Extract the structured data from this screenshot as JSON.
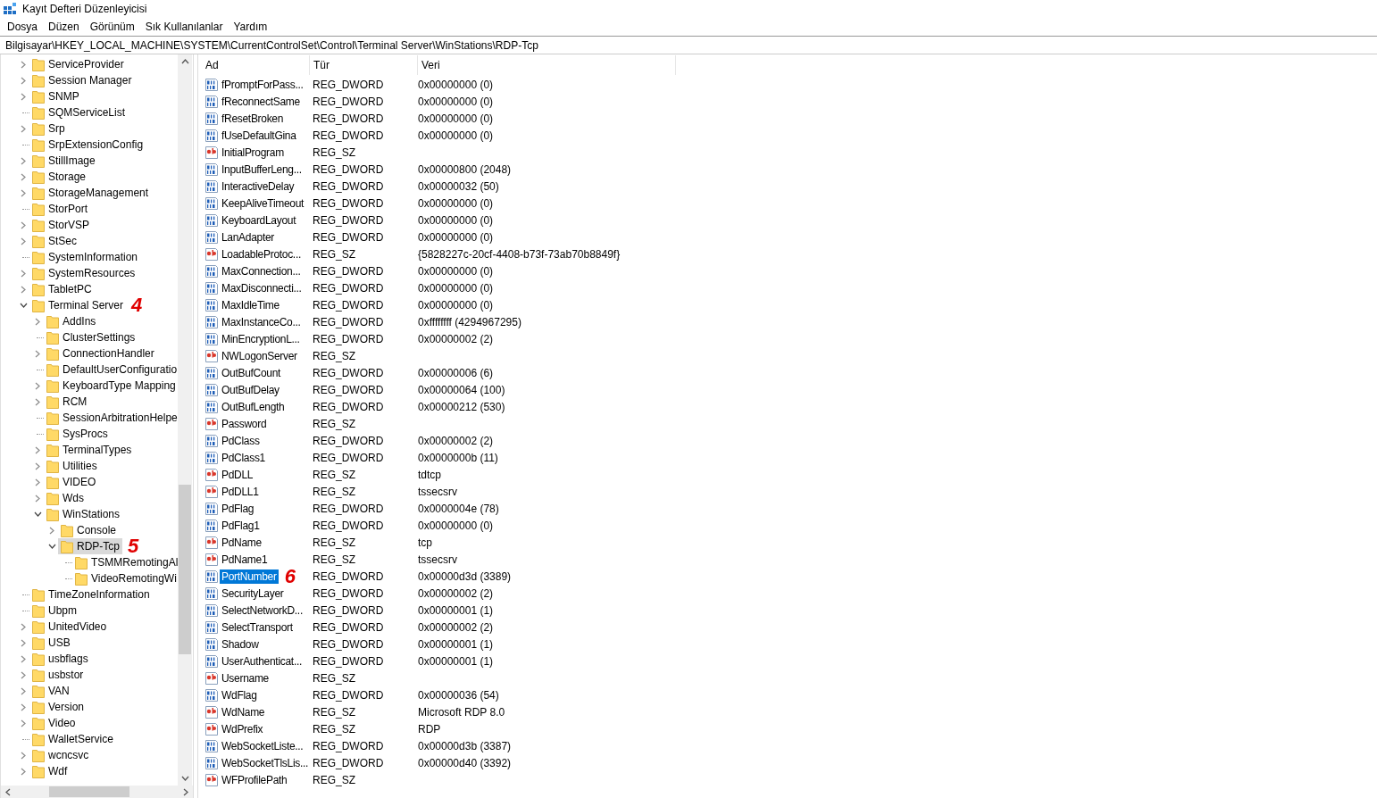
{
  "window": {
    "title": "Kayıt Defteri Düzenleyicisi"
  },
  "menu": [
    "Dosya",
    "Düzen",
    "Görünüm",
    "Sık Kullanılanlar",
    "Yardım"
  ],
  "address": "Bilgisayar\\HKEY_LOCAL_MACHINE\\SYSTEM\\CurrentControlSet\\Control\\Terminal Server\\WinStations\\RDP-Tcp",
  "tree": [
    {
      "label": "ServiceProvider",
      "expandable": true,
      "expanded": false,
      "selected": false
    },
    {
      "label": "Session Manager",
      "expandable": true,
      "expanded": false,
      "selected": false
    },
    {
      "label": "SNMP",
      "expandable": true,
      "expanded": false,
      "selected": false
    },
    {
      "label": "SQMServiceList",
      "expandable": false,
      "selected": false
    },
    {
      "label": "Srp",
      "expandable": true,
      "expanded": false,
      "selected": false
    },
    {
      "label": "SrpExtensionConfig",
      "expandable": false,
      "selected": false
    },
    {
      "label": "StillImage",
      "expandable": true,
      "expanded": false,
      "selected": false
    },
    {
      "label": "Storage",
      "expandable": true,
      "expanded": false,
      "selected": false
    },
    {
      "label": "StorageManagement",
      "expandable": true,
      "expanded": false,
      "selected": false
    },
    {
      "label": "StorPort",
      "expandable": false,
      "selected": false
    },
    {
      "label": "StorVSP",
      "expandable": true,
      "expanded": false,
      "selected": false
    },
    {
      "label": "StSec",
      "expandable": true,
      "expanded": false,
      "selected": false
    },
    {
      "label": "SystemInformation",
      "expandable": false,
      "selected": false
    },
    {
      "label": "SystemResources",
      "expandable": true,
      "expanded": false,
      "selected": false
    },
    {
      "label": "TabletPC",
      "expandable": true,
      "expanded": false,
      "selected": false
    },
    {
      "label": "Terminal Server",
      "expandable": true,
      "expanded": true,
      "selected": false,
      "annotation": "4",
      "children": [
        {
          "label": "AddIns",
          "expandable": true,
          "expanded": false,
          "selected": false
        },
        {
          "label": "ClusterSettings",
          "expandable": false,
          "selected": false
        },
        {
          "label": "ConnectionHandler",
          "expandable": true,
          "expanded": false,
          "selected": false
        },
        {
          "label": "DefaultUserConfiguratio",
          "expandable": false,
          "selected": false
        },
        {
          "label": "KeyboardType Mapping",
          "expandable": true,
          "expanded": false,
          "selected": false
        },
        {
          "label": "RCM",
          "expandable": true,
          "expanded": false,
          "selected": false
        },
        {
          "label": "SessionArbitrationHelpe",
          "expandable": false,
          "selected": false
        },
        {
          "label": "SysProcs",
          "expandable": false,
          "selected": false
        },
        {
          "label": "TerminalTypes",
          "expandable": true,
          "expanded": false,
          "selected": false
        },
        {
          "label": "Utilities",
          "expandable": true,
          "expanded": false,
          "selected": false
        },
        {
          "label": "VIDEO",
          "expandable": true,
          "expanded": false,
          "selected": false
        },
        {
          "label": "Wds",
          "expandable": true,
          "expanded": false,
          "selected": false
        },
        {
          "label": "WinStations",
          "expandable": true,
          "expanded": true,
          "selected": false,
          "children": [
            {
              "label": "Console",
              "expandable": true,
              "expanded": false,
              "selected": false
            },
            {
              "label": "RDP-Tcp",
              "expandable": true,
              "expanded": true,
              "selected": true,
              "annotation": "5",
              "children": [
                {
                  "label": "TSMMRemotingAl",
                  "expandable": false,
                  "selected": false
                },
                {
                  "label": "VideoRemotingWi",
                  "expandable": false,
                  "selected": false
                }
              ]
            }
          ]
        }
      ]
    },
    {
      "label": "TimeZoneInformation",
      "expandable": false,
      "selected": false
    },
    {
      "label": "Ubpm",
      "expandable": false,
      "selected": false
    },
    {
      "label": "UnitedVideo",
      "expandable": true,
      "expanded": false,
      "selected": false
    },
    {
      "label": "USB",
      "expandable": true,
      "expanded": false,
      "selected": false
    },
    {
      "label": "usbflags",
      "expandable": true,
      "expanded": false,
      "selected": false
    },
    {
      "label": "usbstor",
      "expandable": true,
      "expanded": false,
      "selected": false
    },
    {
      "label": "VAN",
      "expandable": true,
      "expanded": false,
      "selected": false
    },
    {
      "label": "Version",
      "expandable": true,
      "expanded": false,
      "selected": false
    },
    {
      "label": "Video",
      "expandable": true,
      "expanded": false,
      "selected": false
    },
    {
      "label": "WalletService",
      "expandable": false,
      "selected": false
    },
    {
      "label": "wcncsvc",
      "expandable": true,
      "expanded": false,
      "selected": false
    },
    {
      "label": "Wdf",
      "expandable": true,
      "expanded": false,
      "selected": false
    }
  ],
  "table": {
    "columns": [
      "Ad",
      "Tür",
      "Veri"
    ],
    "rows": [
      {
        "name": "fPromptForPass...",
        "type": "REG_DWORD",
        "data": "0x00000000 (0)",
        "kind": "binary",
        "selected": false
      },
      {
        "name": "fReconnectSame",
        "type": "REG_DWORD",
        "data": "0x00000000 (0)",
        "kind": "binary",
        "selected": false
      },
      {
        "name": "fResetBroken",
        "type": "REG_DWORD",
        "data": "0x00000000 (0)",
        "kind": "binary",
        "selected": false
      },
      {
        "name": "fUseDefaultGina",
        "type": "REG_DWORD",
        "data": "0x00000000 (0)",
        "kind": "binary",
        "selected": false
      },
      {
        "name": "InitialProgram",
        "type": "REG_SZ",
        "kind": "string",
        "selected": false
      },
      {
        "name": "InputBufferLeng...",
        "type": "REG_DWORD",
        "data": "0x00000800 (2048)",
        "kind": "binary",
        "selected": false
      },
      {
        "name": "InteractiveDelay",
        "type": "REG_DWORD",
        "data": "0x00000032 (50)",
        "kind": "binary",
        "selected": false
      },
      {
        "name": "KeepAliveTimeout",
        "type": "REG_DWORD",
        "data": "0x00000000 (0)",
        "kind": "binary",
        "selected": false
      },
      {
        "name": "KeyboardLayout",
        "type": "REG_DWORD",
        "data": "0x00000000 (0)",
        "kind": "binary",
        "selected": false
      },
      {
        "name": "LanAdapter",
        "type": "REG_DWORD",
        "data": "0x00000000 (0)",
        "kind": "binary",
        "selected": false
      },
      {
        "name": "LoadableProtoc...",
        "type": "REG_SZ",
        "data": "{5828227c-20cf-4408-b73f-73ab70b8849f}",
        "kind": "string",
        "selected": false
      },
      {
        "name": "MaxConnection...",
        "type": "REG_DWORD",
        "data": "0x00000000 (0)",
        "kind": "binary",
        "selected": false
      },
      {
        "name": "MaxDisconnecti...",
        "type": "REG_DWORD",
        "data": "0x00000000 (0)",
        "kind": "binary",
        "selected": false
      },
      {
        "name": "MaxIdleTime",
        "type": "REG_DWORD",
        "data": "0x00000000 (0)",
        "kind": "binary",
        "selected": false
      },
      {
        "name": "MaxInstanceCo...",
        "type": "REG_DWORD",
        "data": "0xffffffff (4294967295)",
        "kind": "binary",
        "selected": false
      },
      {
        "name": "MinEncryptionL...",
        "type": "REG_DWORD",
        "data": "0x00000002 (2)",
        "kind": "binary",
        "selected": false
      },
      {
        "name": "NWLogonServer",
        "type": "REG_SZ",
        "kind": "string",
        "selected": false
      },
      {
        "name": "OutBufCount",
        "type": "REG_DWORD",
        "data": "0x00000006 (6)",
        "kind": "binary",
        "selected": false
      },
      {
        "name": "OutBufDelay",
        "type": "REG_DWORD",
        "data": "0x00000064 (100)",
        "kind": "binary",
        "selected": false
      },
      {
        "name": "OutBufLength",
        "type": "REG_DWORD",
        "data": "0x00000212 (530)",
        "kind": "binary",
        "selected": false
      },
      {
        "name": "Password",
        "type": "REG_SZ",
        "kind": "string",
        "selected": false
      },
      {
        "name": "PdClass",
        "type": "REG_DWORD",
        "data": "0x00000002 (2)",
        "kind": "binary",
        "selected": false
      },
      {
        "name": "PdClass1",
        "type": "REG_DWORD",
        "data": "0x0000000b (11)",
        "kind": "binary",
        "selected": false
      },
      {
        "name": "PdDLL",
        "type": "REG_SZ",
        "data": "tdtcp",
        "kind": "string",
        "selected": false
      },
      {
        "name": "PdDLL1",
        "type": "REG_SZ",
        "data": "tssecsrv",
        "kind": "string",
        "selected": false
      },
      {
        "name": "PdFlag",
        "type": "REG_DWORD",
        "data": "0x0000004e (78)",
        "kind": "binary",
        "selected": false
      },
      {
        "name": "PdFlag1",
        "type": "REG_DWORD",
        "data": "0x00000000 (0)",
        "kind": "binary",
        "selected": false
      },
      {
        "name": "PdName",
        "type": "REG_SZ",
        "data": "tcp",
        "kind": "string",
        "selected": false
      },
      {
        "name": "PdName1",
        "type": "REG_SZ",
        "data": "tssecsrv",
        "kind": "string",
        "selected": false
      },
      {
        "name": "PortNumber",
        "type": "REG_DWORD",
        "data": "0x00000d3d (3389)",
        "kind": "binary",
        "selected": true,
        "annotation": "6"
      },
      {
        "name": "SecurityLayer",
        "type": "REG_DWORD",
        "data": "0x00000002 (2)",
        "kind": "binary",
        "selected": false
      },
      {
        "name": "SelectNetworkD...",
        "type": "REG_DWORD",
        "data": "0x00000001 (1)",
        "kind": "binary",
        "selected": false
      },
      {
        "name": "SelectTransport",
        "type": "REG_DWORD",
        "data": "0x00000002 (2)",
        "kind": "binary",
        "selected": false
      },
      {
        "name": "Shadow",
        "type": "REG_DWORD",
        "data": "0x00000001 (1)",
        "kind": "binary",
        "selected": false
      },
      {
        "name": "UserAuthenticat...",
        "type": "REG_DWORD",
        "data": "0x00000001 (1)",
        "kind": "binary",
        "selected": false
      },
      {
        "name": "Username",
        "type": "REG_SZ",
        "kind": "string",
        "selected": false
      },
      {
        "name": "WdFlag",
        "type": "REG_DWORD",
        "data": "0x00000036 (54)",
        "kind": "binary",
        "selected": false
      },
      {
        "name": "WdName",
        "type": "REG_SZ",
        "data": "Microsoft RDP 8.0",
        "kind": "string",
        "selected": false
      },
      {
        "name": "WdPrefix",
        "type": "REG_SZ",
        "data": "RDP",
        "kind": "string",
        "selected": false
      },
      {
        "name": "WebSocketListe...",
        "type": "REG_DWORD",
        "data": "0x00000d3b (3387)",
        "kind": "binary",
        "selected": false
      },
      {
        "name": "WebSocketTlsLis...",
        "type": "REG_DWORD",
        "data": "0x00000d40 (3392)",
        "kind": "binary",
        "selected": false
      },
      {
        "name": "WFProfilePath",
        "type": "REG_SZ",
        "kind": "string",
        "selected": false
      }
    ]
  }
}
